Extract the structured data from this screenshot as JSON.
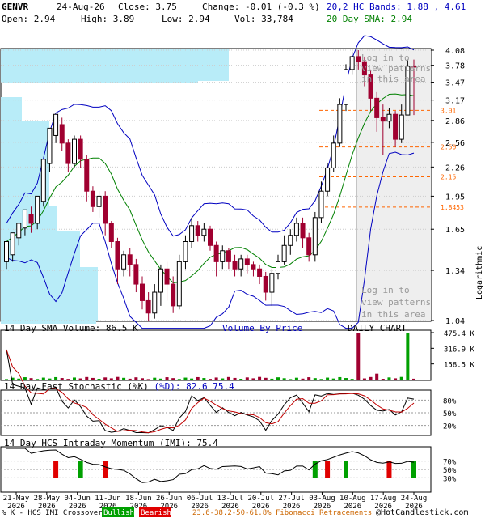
{
  "header": {
    "ticker": "GENVR",
    "date": "24-Aug-26",
    "close_label": "Close: 3.75",
    "change_label": "Change: -0.01 (-0.3 %)",
    "open_label": "Open: 2.94",
    "high_label": "High: 3.89",
    "low_label": "Low: 2.94",
    "vol_label": "Vol: 33,784",
    "bands_label": "20,2 HC Bands: 1.88 , 4.61",
    "sma_label": "20 Day SMA: 2.94"
  },
  "colors": {
    "up": "#00a000",
    "down": "#a00030",
    "band": "#0000c0",
    "sma": "#008000",
    "vbp": "#b8ecf8",
    "fib": "#ff6600",
    "grid": "#cccccc",
    "text_dark": "#000000",
    "text_blue": "#0000c0",
    "text_green": "#008000",
    "pattern_text": "#999999",
    "stoch_k": "#000000",
    "stoch_d": "#c00000",
    "footer_fib": "#cc6600"
  },
  "watermark": {
    "line1": "Log in to",
    "line2": "view patterns",
    "line3": "in this area"
  },
  "labels": {
    "logarithmic": "Logarithmic",
    "volume_title": "14 Day SMA Volume: 86.5 K",
    "vbp_title": "Volume By Price",
    "daily_chart": "DAILY CHART",
    "stoch_title_1": "14 Day Fast Stochastic (%K) ",
    "stoch_title_2": "(%D): 82.6",
    "stoch_title_3": "  75.4",
    "imi_title": "14 Day HCS Intraday Momentum (IMI): 75.4",
    "footer_prefix": "% K - HCS IMI Crossover:",
    "footer_bullish": "Bullish",
    "footer_bearish": "Bearish",
    "footer_fib": "23.6-38.2-50-61.8% Fibonacci Retracements",
    "footer_copyright": "@HotCandlestick.com"
  },
  "chart_data": {
    "type": "candlestick",
    "ticker": "GENVR",
    "price_axis": {
      "scale": "log",
      "ticks": [
        "4.08",
        "3.78",
        "3.47",
        "3.17",
        "2.86",
        "2.56",
        "2.26",
        "1.95",
        "1.65",
        "1.34",
        "1.04"
      ],
      "range": [
        1.04,
        4.08
      ]
    },
    "x_ticks": [
      {
        "line1": "21-May",
        "line2": "2026"
      },
      {
        "line1": "28-May",
        "line2": "2026"
      },
      {
        "line1": "04-Jun",
        "line2": "2026"
      },
      {
        "line1": "11-Jun",
        "line2": "2026"
      },
      {
        "line1": "18-Jun",
        "line2": "2026"
      },
      {
        "line1": "26-Jun",
        "line2": "2026"
      },
      {
        "line1": "06-Jul",
        "line2": "2026"
      },
      {
        "line1": "13-Jul",
        "line2": "2026"
      },
      {
        "line1": "20-Jul",
        "line2": "2026"
      },
      {
        "line1": "27-Jul",
        "line2": "2026"
      },
      {
        "line1": "03-Aug",
        "line2": "2026"
      },
      {
        "line1": "10-Aug",
        "line2": "2026"
      },
      {
        "line1": "17-Aug",
        "line2": "2026"
      },
      {
        "line1": "24-Aug",
        "line2": "2026"
      }
    ],
    "fib_levels": [
      "3.01",
      "2.50",
      "2.15",
      "1.8453"
    ],
    "candles": [
      [
        1.4,
        1.55,
        1.35,
        1.45
      ],
      [
        1.45,
        1.62,
        1.4,
        1.58
      ],
      [
        1.58,
        1.7,
        1.52,
        1.66
      ],
      [
        1.66,
        1.82,
        1.6,
        1.78
      ],
      [
        1.78,
        1.7,
        1.62,
        1.85
      ],
      [
        1.7,
        1.95,
        1.65,
        1.9
      ],
      [
        1.9,
        2.35,
        1.85,
        2.3
      ],
      [
        2.3,
        2.75,
        2.2,
        2.65
      ],
      [
        2.65,
        2.95,
        2.55,
        2.8
      ],
      [
        2.8,
        2.55,
        2.45,
        2.9
      ],
      [
        2.55,
        2.3,
        2.2,
        2.6
      ],
      [
        2.3,
        2.6,
        2.25,
        2.65
      ],
      [
        2.6,
        2.35,
        2.25,
        2.65
      ],
      [
        2.35,
        2.0,
        1.9,
        2.4
      ],
      [
        2.0,
        1.85,
        1.8,
        2.05
      ],
      [
        1.85,
        1.95,
        1.75,
        2.0
      ],
      [
        1.95,
        1.7,
        1.6,
        2.0
      ],
      [
        1.7,
        1.55,
        1.5,
        1.72
      ],
      [
        1.55,
        1.35,
        1.25,
        1.58
      ],
      [
        1.35,
        1.45,
        1.3,
        1.48
      ],
      [
        1.45,
        1.38,
        1.3,
        1.5
      ],
      [
        1.38,
        1.25,
        1.2,
        1.42
      ],
      [
        1.25,
        1.15,
        1.1,
        1.3
      ],
      [
        1.15,
        1.08,
        1.04,
        1.2
      ],
      [
        1.08,
        1.2,
        1.05,
        1.25
      ],
      [
        1.2,
        1.35,
        1.12,
        1.38
      ],
      [
        1.35,
        1.25,
        1.15,
        1.4
      ],
      [
        1.25,
        1.12,
        1.08,
        1.3
      ],
      [
        1.12,
        1.4,
        1.1,
        1.45
      ],
      [
        1.4,
        1.55,
        1.35,
        1.6
      ],
      [
        1.55,
        1.68,
        1.5,
        1.75
      ],
      [
        1.68,
        1.6,
        1.55,
        1.72
      ],
      [
        1.6,
        1.65,
        1.55,
        1.7
      ],
      [
        1.65,
        1.52,
        1.48,
        1.68
      ],
      [
        1.52,
        1.4,
        1.3,
        1.55
      ],
      [
        1.4,
        1.48,
        1.35,
        1.52
      ],
      [
        1.48,
        1.4,
        1.35,
        1.5
      ],
      [
        1.4,
        1.35,
        1.3,
        1.45
      ],
      [
        1.35,
        1.42,
        1.3,
        1.45
      ],
      [
        1.42,
        1.38,
        1.32,
        1.45
      ],
      [
        1.38,
        1.35,
        1.3,
        1.4
      ],
      [
        1.35,
        1.3,
        1.25,
        1.38
      ],
      [
        1.3,
        1.2,
        1.15,
        1.33
      ],
      [
        1.2,
        1.32,
        1.12,
        1.35
      ],
      [
        1.32,
        1.4,
        1.28,
        1.45
      ],
      [
        1.4,
        1.52,
        1.38,
        1.6
      ],
      [
        1.52,
        1.6,
        1.45,
        1.65
      ],
      [
        1.6,
        1.7,
        1.55,
        1.75
      ],
      [
        1.7,
        1.58,
        1.5,
        1.75
      ],
      [
        1.58,
        1.45,
        1.4,
        1.62
      ],
      [
        1.45,
        1.75,
        1.4,
        1.8
      ],
      [
        1.75,
        2.0,
        1.7,
        2.1
      ],
      [
        2.0,
        2.25,
        1.95,
        2.3
      ],
      [
        2.25,
        2.55,
        2.2,
        2.65
      ],
      [
        2.55,
        3.1,
        2.5,
        3.2
      ],
      [
        3.1,
        3.7,
        3.0,
        3.8
      ],
      [
        3.7,
        3.95,
        3.6,
        4.05
      ],
      [
        3.95,
        3.85,
        3.7,
        4.08
      ],
      [
        3.85,
        3.6,
        3.4,
        3.95
      ],
      [
        3.6,
        3.2,
        3.0,
        3.7
      ],
      [
        3.2,
        2.9,
        2.7,
        3.3
      ],
      [
        2.9,
        2.85,
        2.4,
        3.1
      ],
      [
        2.85,
        2.95,
        2.75,
        3.05
      ],
      [
        2.95,
        2.6,
        2.5,
        3.0
      ],
      [
        2.6,
        2.94,
        2.55,
        3.1
      ],
      [
        2.94,
        3.76,
        2.94,
        3.89
      ],
      [
        3.76,
        3.75,
        2.94,
        3.89
      ]
    ],
    "volume_axis": [
      "475.4 K",
      "316.9 K",
      "158.5 K"
    ],
    "stochastic": {
      "k": 82.6,
      "d": 75.4,
      "levels": [
        "80%",
        "50%",
        "20%"
      ]
    },
    "imi": {
      "value": 75.4,
      "levels": [
        "70%",
        "50%",
        "30%"
      ]
    }
  }
}
